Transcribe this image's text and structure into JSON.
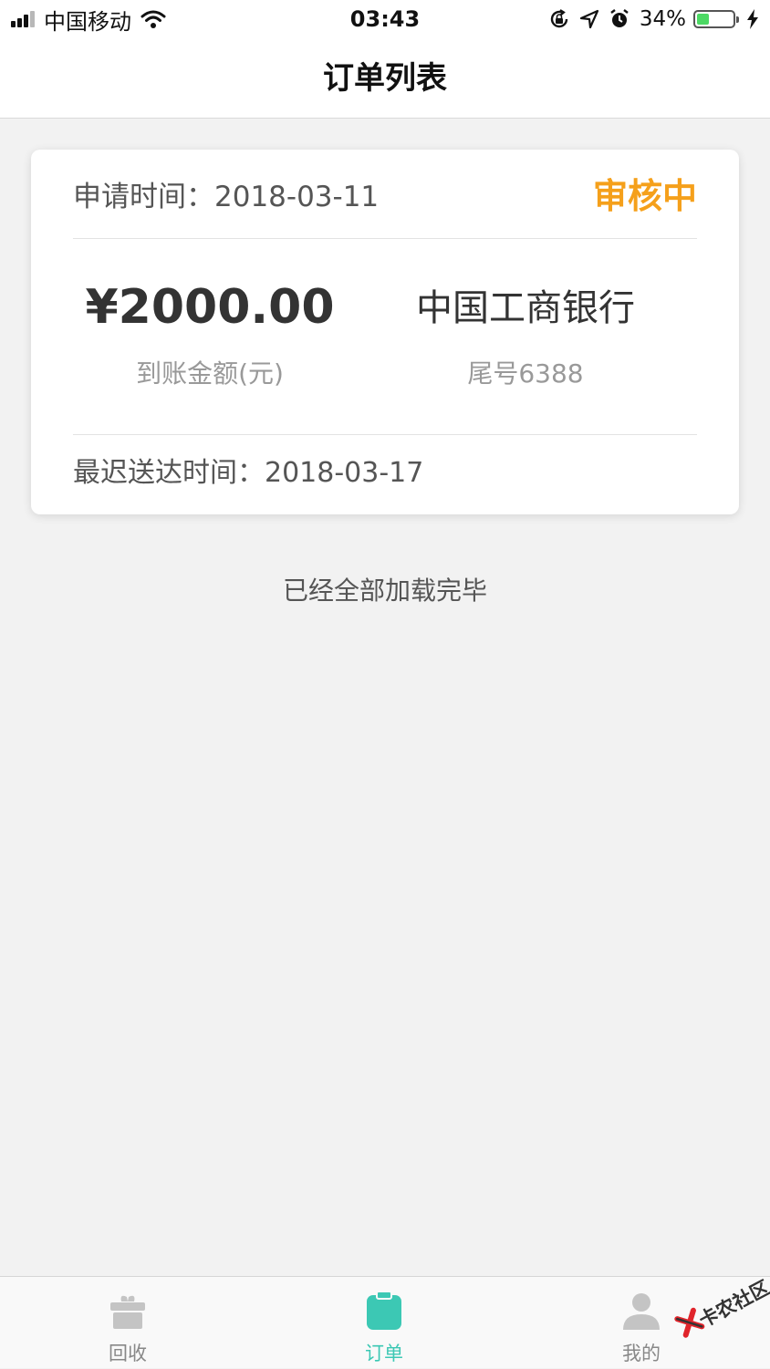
{
  "status_bar": {
    "carrier": "中国移动",
    "time": "03:43",
    "battery_percent": "34%",
    "battery_level": 0.34,
    "signal_bars": 3,
    "icons": [
      "signal-icon",
      "wifi-icon",
      "rotation-lock-icon",
      "location-arrow-icon",
      "alarm-icon",
      "battery-icon",
      "charging-bolt-icon"
    ]
  },
  "nav": {
    "title": "订单列表"
  },
  "order_card": {
    "apply_time_label": "申请时间：",
    "apply_time": "2018-03-11",
    "status": "审核中",
    "status_color": "#f5a01b",
    "amount": "¥2000.00",
    "amount_label": "到账金额(元)",
    "bank_name": "中国工商银行",
    "card_tail": "尾号6388",
    "deliver_label": "最迟送达时间：",
    "deliver_time": "2018-03-17"
  },
  "list_footer": {
    "message": "已经全部加载完毕"
  },
  "tab_bar": {
    "active_color": "#3cc8b4",
    "tabs": [
      {
        "label": "回收",
        "icon": "gift-box-icon",
        "active": false
      },
      {
        "label": "订单",
        "icon": "clipboard-icon",
        "active": true
      },
      {
        "label": "我的",
        "icon": "user-icon",
        "active": false
      }
    ]
  },
  "watermark": {
    "text": "卡农社区",
    "icon": "kanong-logo-icon"
  }
}
